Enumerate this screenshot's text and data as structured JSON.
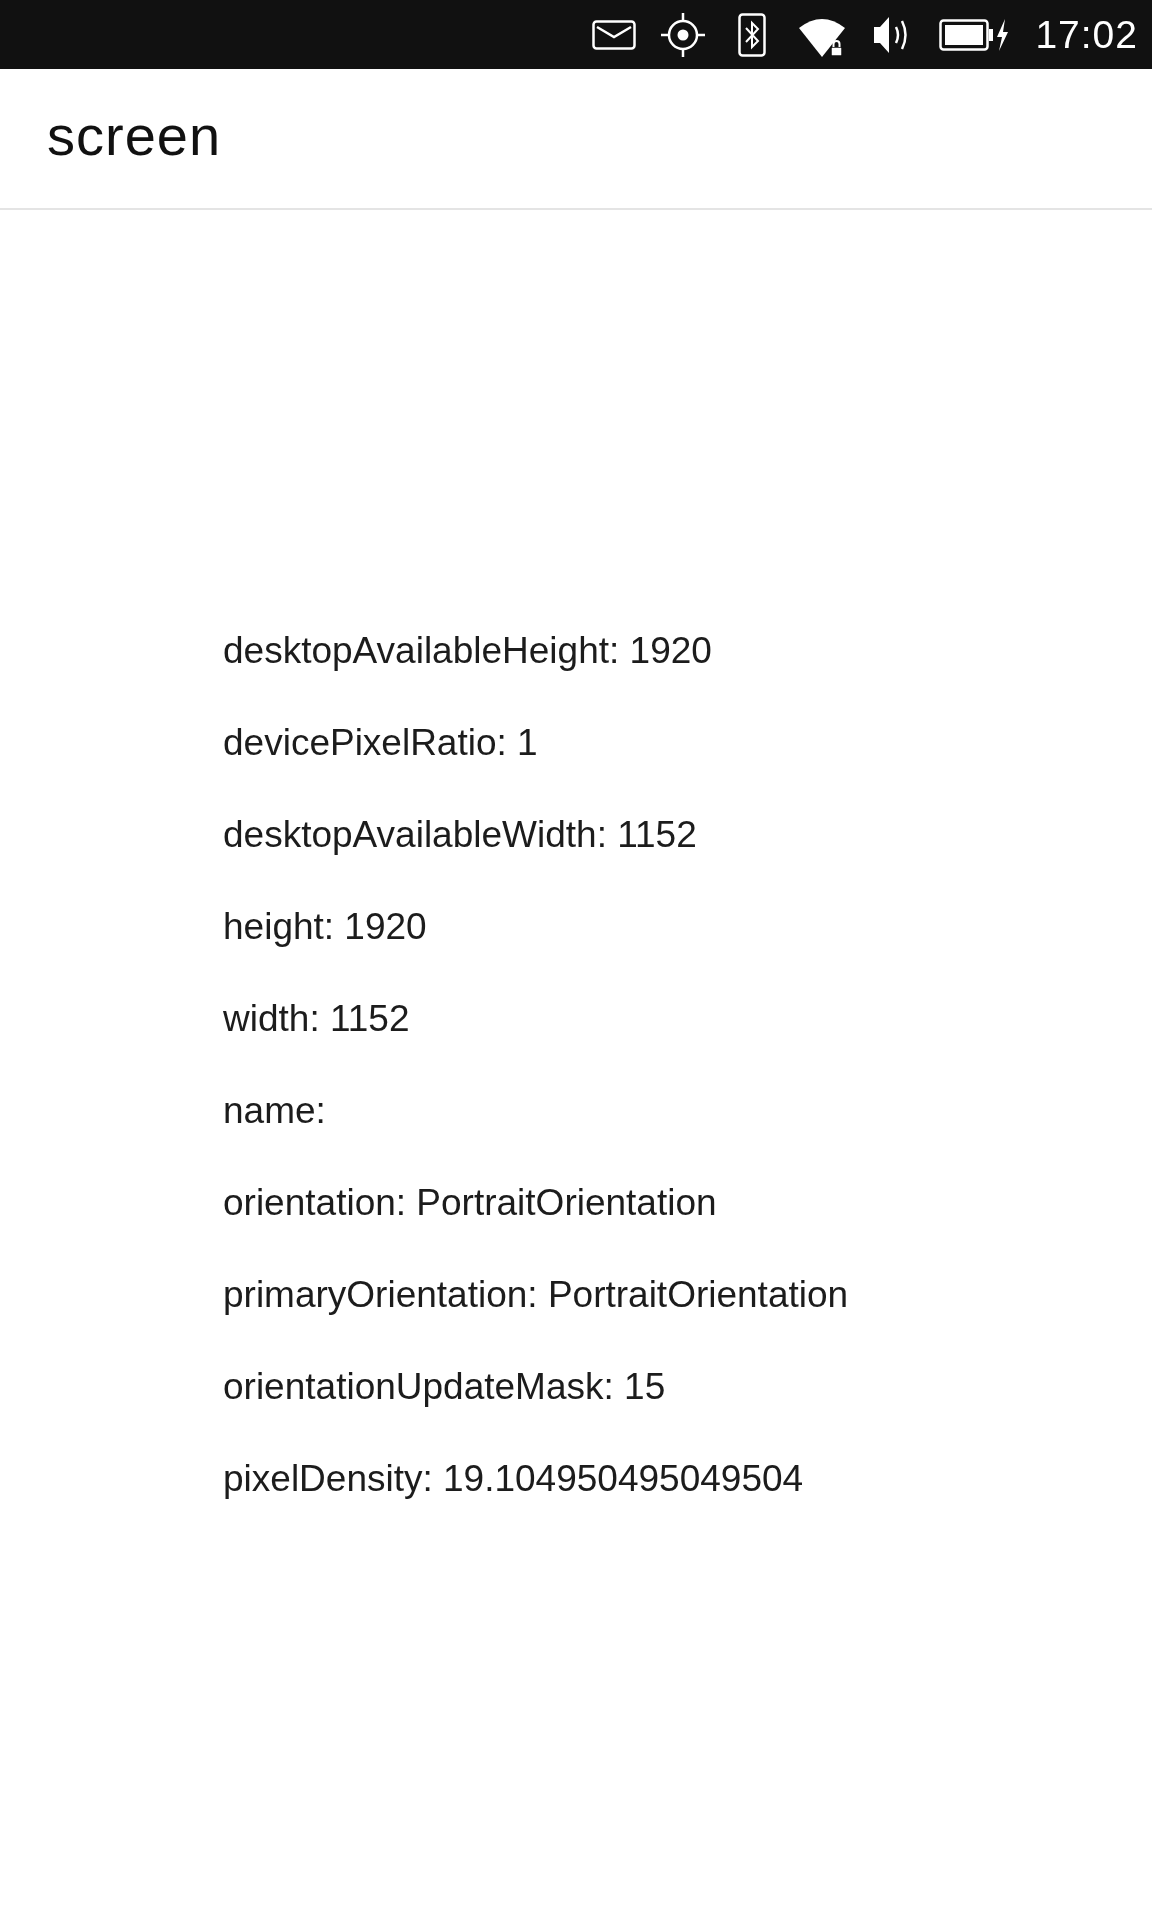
{
  "status_bar": {
    "time": "17:02"
  },
  "header": {
    "title": "screen"
  },
  "properties": [
    "desktopAvailableHeight: 1920",
    "devicePixelRatio: 1",
    "desktopAvailableWidth: 1152",
    "height: 1920",
    "width: 1152",
    "name:",
    "orientation: PortraitOrientation",
    "primaryOrientation: PortraitOrientation",
    "orientationUpdateMask: 15",
    "pixelDensity: 19.104950495049504"
  ]
}
